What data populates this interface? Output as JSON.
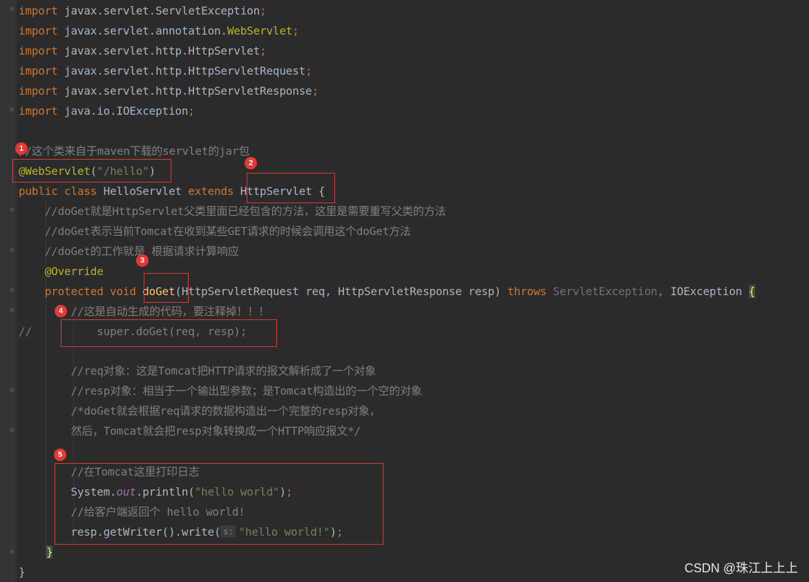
{
  "code": {
    "l1": {
      "kw": "import",
      "rest": " javax.servlet.ServletException",
      "semi": ";"
    },
    "l2": {
      "kw": "import",
      "rest": " javax.servlet.annotation.",
      "cls": "WebServlet",
      "semi": ";"
    },
    "l3": {
      "kw": "import",
      "rest": " javax.servlet.http.HttpServlet",
      "semi": ";"
    },
    "l4": {
      "kw": "import",
      "rest": " javax.servlet.http.HttpServletRequest",
      "semi": ";"
    },
    "l5": {
      "kw": "import",
      "rest": " javax.servlet.http.HttpServletResponse",
      "semi": ";"
    },
    "l6": {
      "kw": "import",
      "rest": " java.io.IOException",
      "semi": ";"
    },
    "l7": {
      "text": "//这个类来自于maven下载的servlet的jar包"
    },
    "l8": {
      "ann": "@WebServlet",
      "open": "(",
      "str": "\"/hello\"",
      "close": ")"
    },
    "l9": {
      "kw1": "public class",
      "name": " HelloServlet ",
      "kw2": "extends",
      "space": " ",
      "parent": "HttpServlet",
      "brace": " {"
    },
    "l10": {
      "text": "    //doGet就是HttpServlet父类里面已经包含的方法，这里是需要重写父类的方法"
    },
    "l11": {
      "text": "    //doGet表示当前Tomcat在收到某些GET请求的时候会调用这个doGet方法"
    },
    "l12": {
      "text": "    //doGet的工作就是 根据请求计算响应"
    },
    "l13": {
      "ann": "    @Override"
    },
    "l14": {
      "kw": "    protected void ",
      "fn": "doGet",
      "params": "(HttpServletRequest req, HttpServletResponse resp) ",
      "throws": "throws ",
      "exc1": "ServletException",
      "comma": ", ",
      "exc2": "IOException ",
      "brace": "{"
    },
    "l15": {
      "text": "        //这是自动生成的代码，要注释掉！！！"
    },
    "l16": {
      "prefix": "//",
      "code": "          super.doGet(req, resp);"
    },
    "l17": {
      "text": "        //req对象：这是Tomcat把HTTP请求的报文解析成了一个对象"
    },
    "l18": {
      "text": "        //resp对象：相当于一个输出型参数；是Tomcat构造出的一个空的对象"
    },
    "l19": {
      "text": "        /*doGet就会根据req请求的数据构造出一个完整的resp对象，"
    },
    "l20": {
      "text": "        然后，Tomcat就会把resp对象转换成一个HTTP响应报文*/"
    },
    "l21": {
      "text": "        //在Tomcat这里打印日志"
    },
    "l22": {
      "pre": "        System.",
      "field": "out",
      "mid": ".println(",
      "str": "\"hello world\"",
      "post": ")",
      "semi": ";"
    },
    "l23": {
      "text": "        //给客户端返回个 hello world!"
    },
    "l24": {
      "pre": "        resp.getWriter().write(",
      "hint": "s:",
      "str": "\"hello world!\"",
      "post": ")",
      "semi": ";"
    },
    "l25": {
      "brace": "}"
    },
    "l26": {
      "brace": "}"
    }
  },
  "badges": {
    "b1": "1",
    "b2": "2",
    "b3": "3",
    "b4": "4",
    "b5": "5"
  },
  "watermark": "CSDN @珠江上上上",
  "colors": {
    "background": "#2b2b2b",
    "keyword": "#cc7832",
    "annotation": "#bbb529",
    "string": "#6a8759",
    "comment": "#808080",
    "method": "#ffc66d",
    "highlight_box": "#e23b3b"
  }
}
